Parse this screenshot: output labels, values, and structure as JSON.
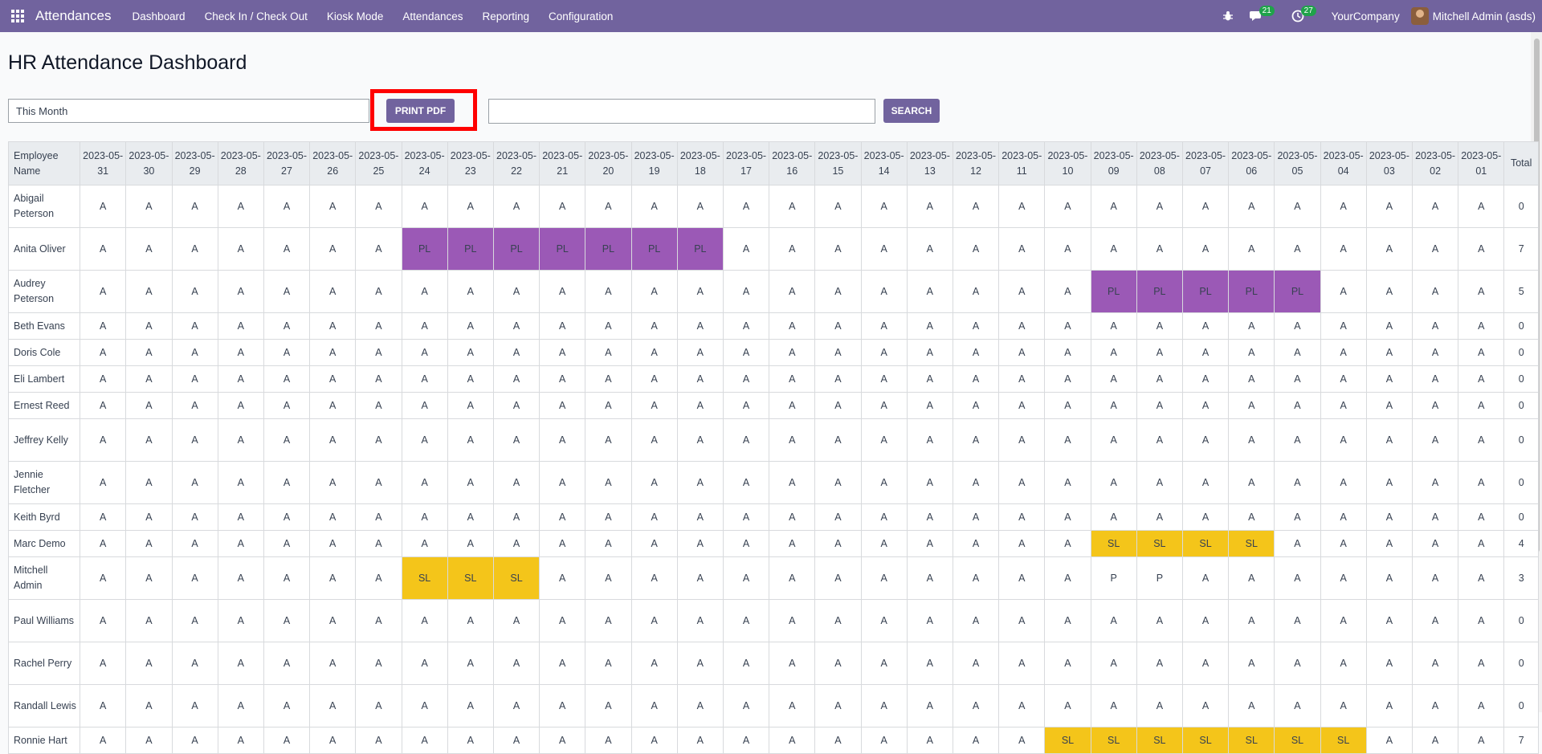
{
  "navbar": {
    "app_name": "Attendances",
    "menu": [
      "Dashboard",
      "Check In / Check Out",
      "Kiosk Mode",
      "Attendances",
      "Reporting",
      "Configuration"
    ],
    "messages_count": "21",
    "activities_count": "27",
    "company": "YourCompany",
    "user": "Mitchell Admin (asds)",
    "icons": [
      "apps-grid-icon",
      "bug-icon",
      "chat-icon",
      "clock-icon"
    ],
    "color": "#71639e"
  },
  "page": {
    "title": "HR Attendance Dashboard",
    "filter_value": "This Month",
    "print_button": "PRINT PDF",
    "search_value": "",
    "search_button": "SEARCH"
  },
  "table": {
    "name_header": "Employee Name",
    "total_header": "Total",
    "dates": [
      "2023-05-31",
      "2023-05-30",
      "2023-05-29",
      "2023-05-28",
      "2023-05-27",
      "2023-05-26",
      "2023-05-25",
      "2023-05-24",
      "2023-05-23",
      "2023-05-22",
      "2023-05-21",
      "2023-05-20",
      "2023-05-19",
      "2023-05-18",
      "2023-05-17",
      "2023-05-16",
      "2023-05-15",
      "2023-05-14",
      "2023-05-13",
      "2023-05-12",
      "2023-05-11",
      "2023-05-10",
      "2023-05-09",
      "2023-05-08",
      "2023-05-07",
      "2023-05-06",
      "2023-05-05",
      "2023-05-04",
      "2023-05-03",
      "2023-05-02",
      "2023-05-01"
    ],
    "status_colors": {
      "PL": "#9b59b6",
      "SL": "#f4c51a"
    },
    "rows": [
      {
        "name": "Abigail Peterson",
        "cells": [
          "A",
          "A",
          "A",
          "A",
          "A",
          "A",
          "A",
          "A",
          "A",
          "A",
          "A",
          "A",
          "A",
          "A",
          "A",
          "A",
          "A",
          "A",
          "A",
          "A",
          "A",
          "A",
          "A",
          "A",
          "A",
          "A",
          "A",
          "A",
          "A",
          "A",
          "A"
        ],
        "total": "0"
      },
      {
        "name": "Anita Oliver",
        "cells": [
          "A",
          "A",
          "A",
          "A",
          "A",
          "A",
          "A",
          "PL",
          "PL",
          "PL",
          "PL",
          "PL",
          "PL",
          "PL",
          "A",
          "A",
          "A",
          "A",
          "A",
          "A",
          "A",
          "A",
          "A",
          "A",
          "A",
          "A",
          "A",
          "A",
          "A",
          "A",
          "A"
        ],
        "total": "7"
      },
      {
        "name": "Audrey Peterson",
        "cells": [
          "A",
          "A",
          "A",
          "A",
          "A",
          "A",
          "A",
          "A",
          "A",
          "A",
          "A",
          "A",
          "A",
          "A",
          "A",
          "A",
          "A",
          "A",
          "A",
          "A",
          "A",
          "A",
          "PL",
          "PL",
          "PL",
          "PL",
          "PL",
          "A",
          "A",
          "A",
          "A"
        ],
        "total": "5"
      },
      {
        "name": "Beth Evans",
        "cells": [
          "A",
          "A",
          "A",
          "A",
          "A",
          "A",
          "A",
          "A",
          "A",
          "A",
          "A",
          "A",
          "A",
          "A",
          "A",
          "A",
          "A",
          "A",
          "A",
          "A",
          "A",
          "A",
          "A",
          "A",
          "A",
          "A",
          "A",
          "A",
          "A",
          "A",
          "A"
        ],
        "total": "0"
      },
      {
        "name": "Doris Cole",
        "cells": [
          "A",
          "A",
          "A",
          "A",
          "A",
          "A",
          "A",
          "A",
          "A",
          "A",
          "A",
          "A",
          "A",
          "A",
          "A",
          "A",
          "A",
          "A",
          "A",
          "A",
          "A",
          "A",
          "A",
          "A",
          "A",
          "A",
          "A",
          "A",
          "A",
          "A",
          "A"
        ],
        "total": "0"
      },
      {
        "name": "Eli Lambert",
        "cells": [
          "A",
          "A",
          "A",
          "A",
          "A",
          "A",
          "A",
          "A",
          "A",
          "A",
          "A",
          "A",
          "A",
          "A",
          "A",
          "A",
          "A",
          "A",
          "A",
          "A",
          "A",
          "A",
          "A",
          "A",
          "A",
          "A",
          "A",
          "A",
          "A",
          "A",
          "A"
        ],
        "total": "0"
      },
      {
        "name": "Ernest Reed",
        "cells": [
          "A",
          "A",
          "A",
          "A",
          "A",
          "A",
          "A",
          "A",
          "A",
          "A",
          "A",
          "A",
          "A",
          "A",
          "A",
          "A",
          "A",
          "A",
          "A",
          "A",
          "A",
          "A",
          "A",
          "A",
          "A",
          "A",
          "A",
          "A",
          "A",
          "A",
          "A"
        ],
        "total": "0"
      },
      {
        "name": "Jeffrey Kelly",
        "cells": [
          "A",
          "A",
          "A",
          "A",
          "A",
          "A",
          "A",
          "A",
          "A",
          "A",
          "A",
          "A",
          "A",
          "A",
          "A",
          "A",
          "A",
          "A",
          "A",
          "A",
          "A",
          "A",
          "A",
          "A",
          "A",
          "A",
          "A",
          "A",
          "A",
          "A",
          "A"
        ],
        "total": "0"
      },
      {
        "name": "Jennie Fletcher",
        "cells": [
          "A",
          "A",
          "A",
          "A",
          "A",
          "A",
          "A",
          "A",
          "A",
          "A",
          "A",
          "A",
          "A",
          "A",
          "A",
          "A",
          "A",
          "A",
          "A",
          "A",
          "A",
          "A",
          "A",
          "A",
          "A",
          "A",
          "A",
          "A",
          "A",
          "A",
          "A"
        ],
        "total": "0"
      },
      {
        "name": "Keith Byrd",
        "cells": [
          "A",
          "A",
          "A",
          "A",
          "A",
          "A",
          "A",
          "A",
          "A",
          "A",
          "A",
          "A",
          "A",
          "A",
          "A",
          "A",
          "A",
          "A",
          "A",
          "A",
          "A",
          "A",
          "A",
          "A",
          "A",
          "A",
          "A",
          "A",
          "A",
          "A",
          "A"
        ],
        "total": "0"
      },
      {
        "name": "Marc Demo",
        "cells": [
          "A",
          "A",
          "A",
          "A",
          "A",
          "A",
          "A",
          "A",
          "A",
          "A",
          "A",
          "A",
          "A",
          "A",
          "A",
          "A",
          "A",
          "A",
          "A",
          "A",
          "A",
          "A",
          "SL",
          "SL",
          "SL",
          "SL",
          "A",
          "A",
          "A",
          "A",
          "A"
        ],
        "total": "4"
      },
      {
        "name": "Mitchell Admin",
        "cells": [
          "A",
          "A",
          "A",
          "A",
          "A",
          "A",
          "A",
          "SL",
          "SL",
          "SL",
          "A",
          "A",
          "A",
          "A",
          "A",
          "A",
          "A",
          "A",
          "A",
          "A",
          "A",
          "A",
          "P",
          "P",
          "A",
          "A",
          "A",
          "A",
          "A",
          "A",
          "A"
        ],
        "total": "3"
      },
      {
        "name": "Paul Williams",
        "cells": [
          "A",
          "A",
          "A",
          "A",
          "A",
          "A",
          "A",
          "A",
          "A",
          "A",
          "A",
          "A",
          "A",
          "A",
          "A",
          "A",
          "A",
          "A",
          "A",
          "A",
          "A",
          "A",
          "A",
          "A",
          "A",
          "A",
          "A",
          "A",
          "A",
          "A",
          "A"
        ],
        "total": "0"
      },
      {
        "name": "Rachel Perry",
        "cells": [
          "A",
          "A",
          "A",
          "A",
          "A",
          "A",
          "A",
          "A",
          "A",
          "A",
          "A",
          "A",
          "A",
          "A",
          "A",
          "A",
          "A",
          "A",
          "A",
          "A",
          "A",
          "A",
          "A",
          "A",
          "A",
          "A",
          "A",
          "A",
          "A",
          "A",
          "A"
        ],
        "total": "0"
      },
      {
        "name": "Randall Lewis",
        "cells": [
          "A",
          "A",
          "A",
          "A",
          "A",
          "A",
          "A",
          "A",
          "A",
          "A",
          "A",
          "A",
          "A",
          "A",
          "A",
          "A",
          "A",
          "A",
          "A",
          "A",
          "A",
          "A",
          "A",
          "A",
          "A",
          "A",
          "A",
          "A",
          "A",
          "A",
          "A"
        ],
        "total": "0"
      },
      {
        "name": "Ronnie Hart",
        "cells": [
          "A",
          "A",
          "A",
          "A",
          "A",
          "A",
          "A",
          "A",
          "A",
          "A",
          "A",
          "A",
          "A",
          "A",
          "A",
          "A",
          "A",
          "A",
          "A",
          "A",
          "A",
          "SL",
          "SL",
          "SL",
          "SL",
          "SL",
          "SL",
          "SL",
          "A",
          "A",
          "A"
        ],
        "total": "7"
      }
    ]
  }
}
